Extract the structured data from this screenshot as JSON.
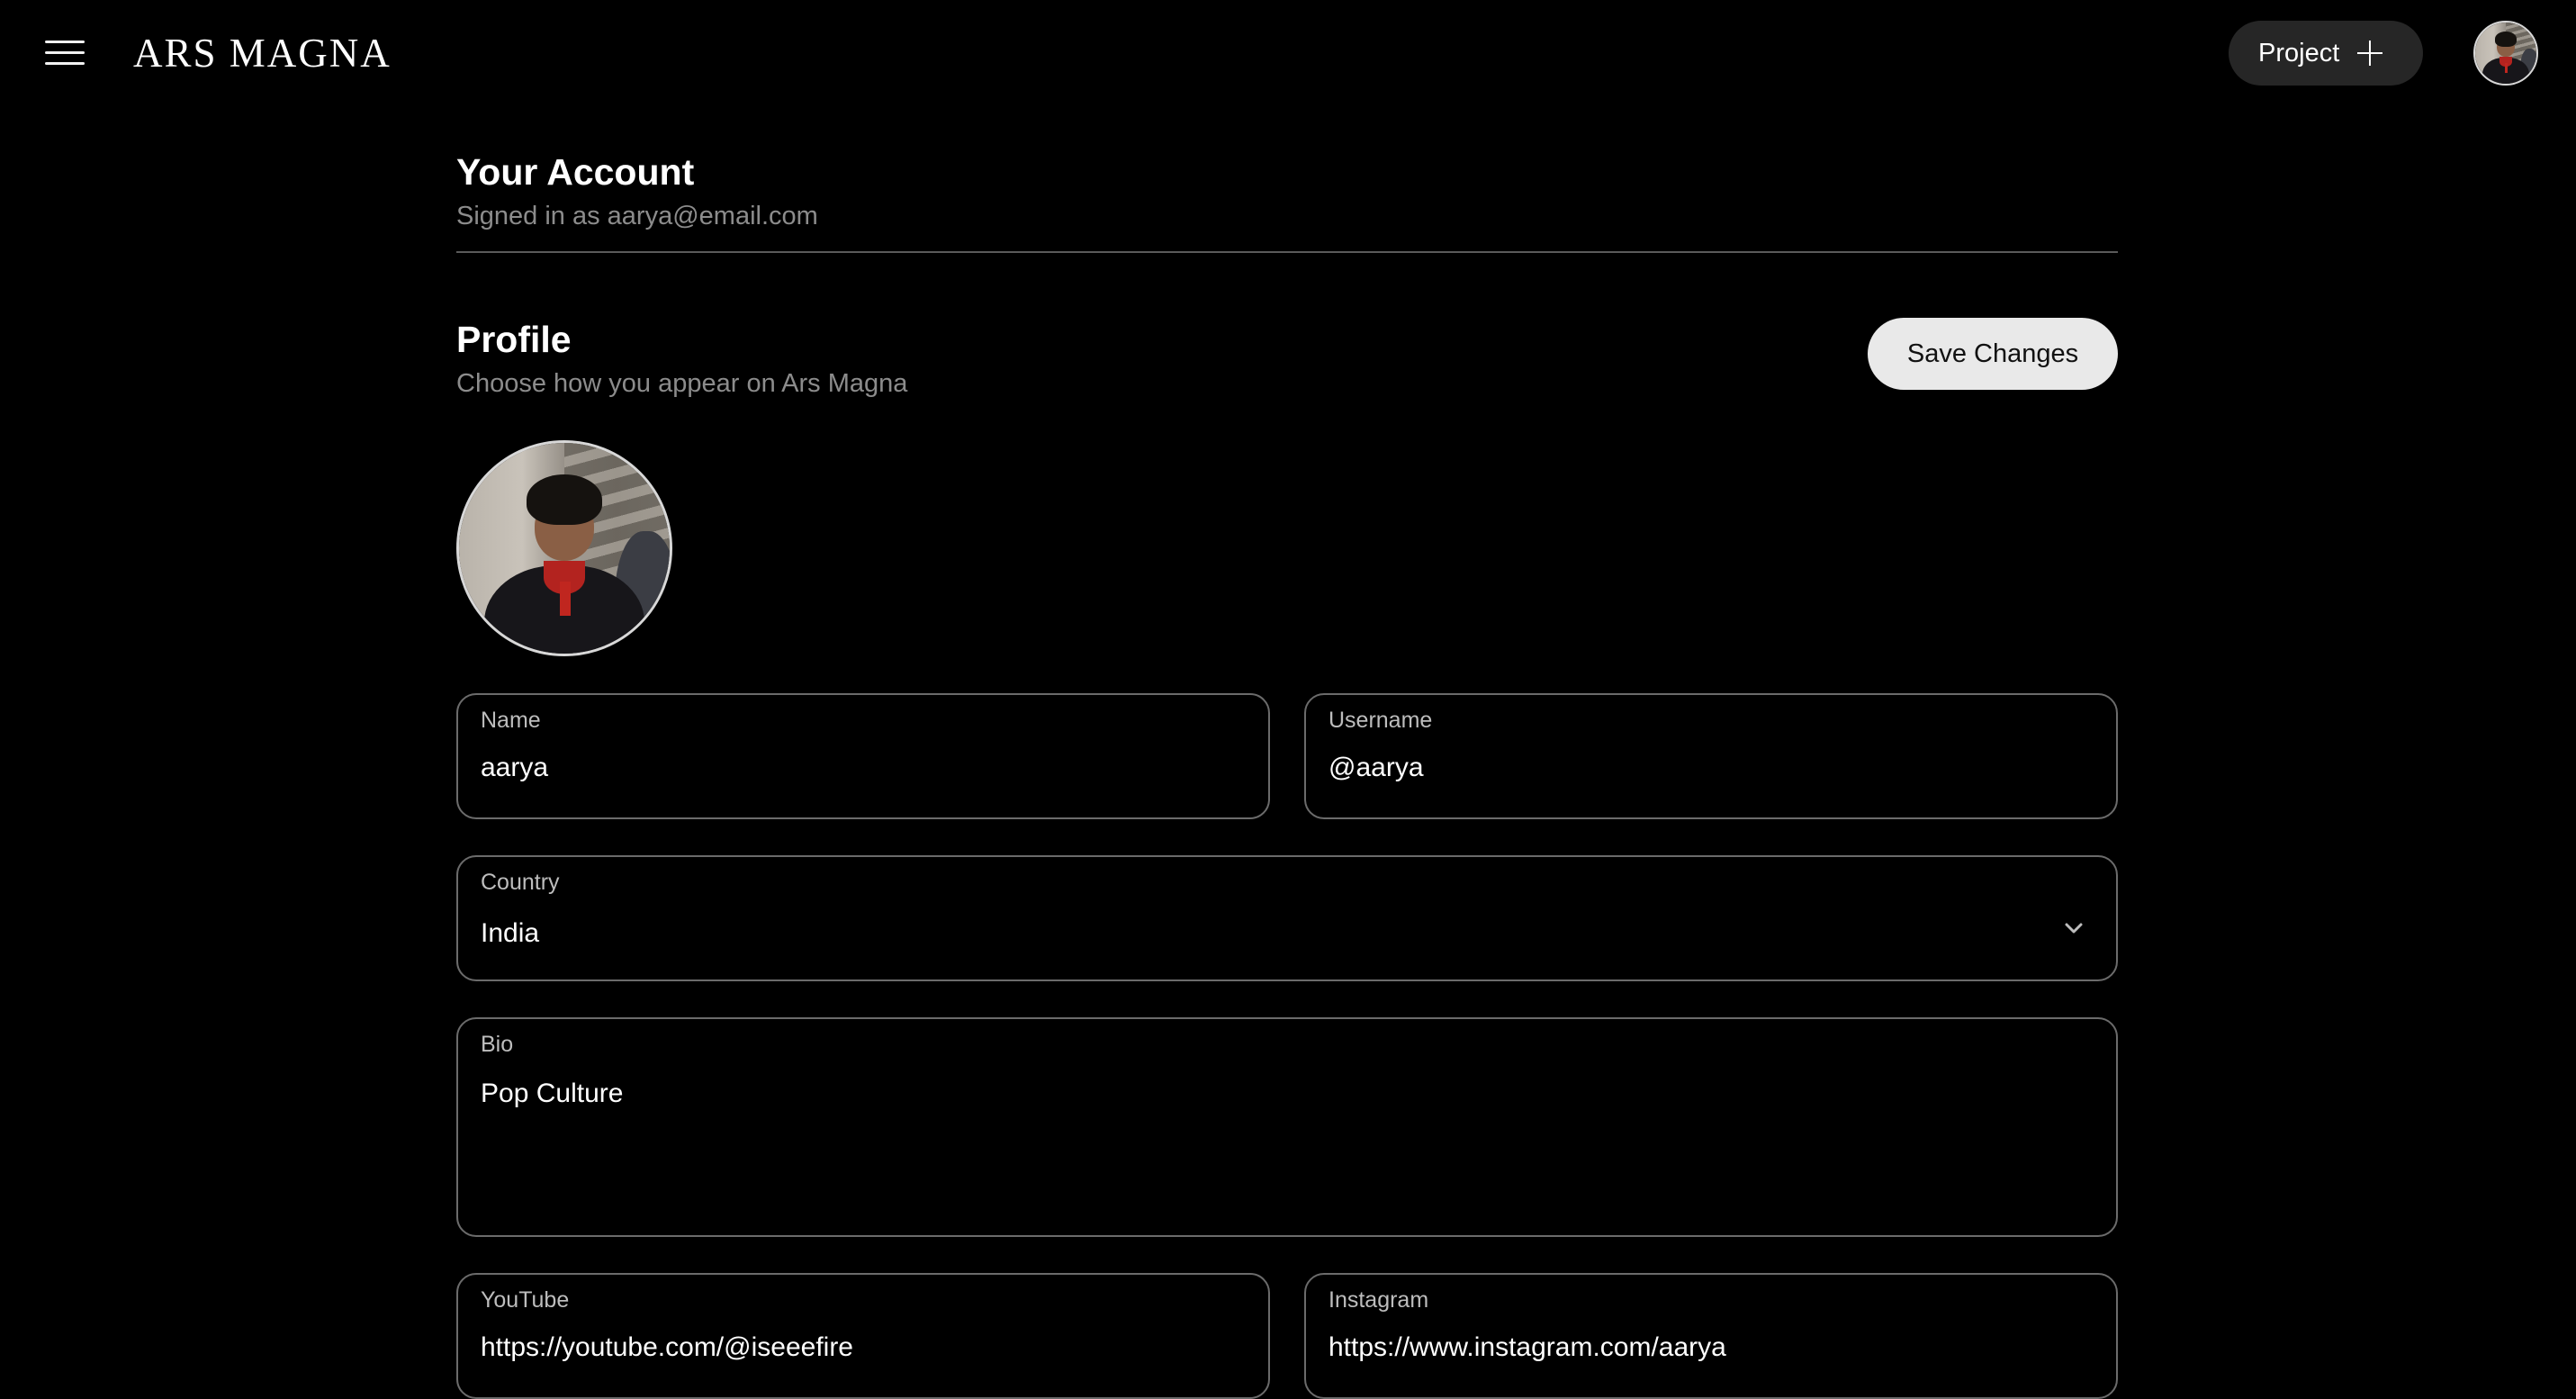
{
  "header": {
    "brand": "ARS MAGNA",
    "project_label": "Project",
    "icons": {
      "menu": "hamburger-menu-icon",
      "project_add": "plus-icon"
    }
  },
  "account": {
    "title": "Your Account",
    "signed_in_text": "Signed in as aarya@email.com"
  },
  "profile": {
    "title": "Profile",
    "subtitle": "Choose how you appear on Ars Magna",
    "save_label": "Save Changes",
    "fields": {
      "name": {
        "label": "Name",
        "value": "aarya"
      },
      "username": {
        "label": "Username",
        "value": "@aarya"
      },
      "country": {
        "label": "Country",
        "value": "India"
      },
      "bio": {
        "label": "Bio",
        "value": "Pop Culture"
      },
      "youtube": {
        "label": "YouTube",
        "value": "https://youtube.com/@iseeefire"
      },
      "instagram": {
        "label": "Instagram",
        "value": "https://www.instagram.com/aarya"
      }
    }
  },
  "colors": {
    "background": "#000000",
    "button_dark": "#262626",
    "button_light": "#e9e9e9",
    "field_border": "#6b6b6b",
    "muted_text": "#8c8c8c"
  }
}
